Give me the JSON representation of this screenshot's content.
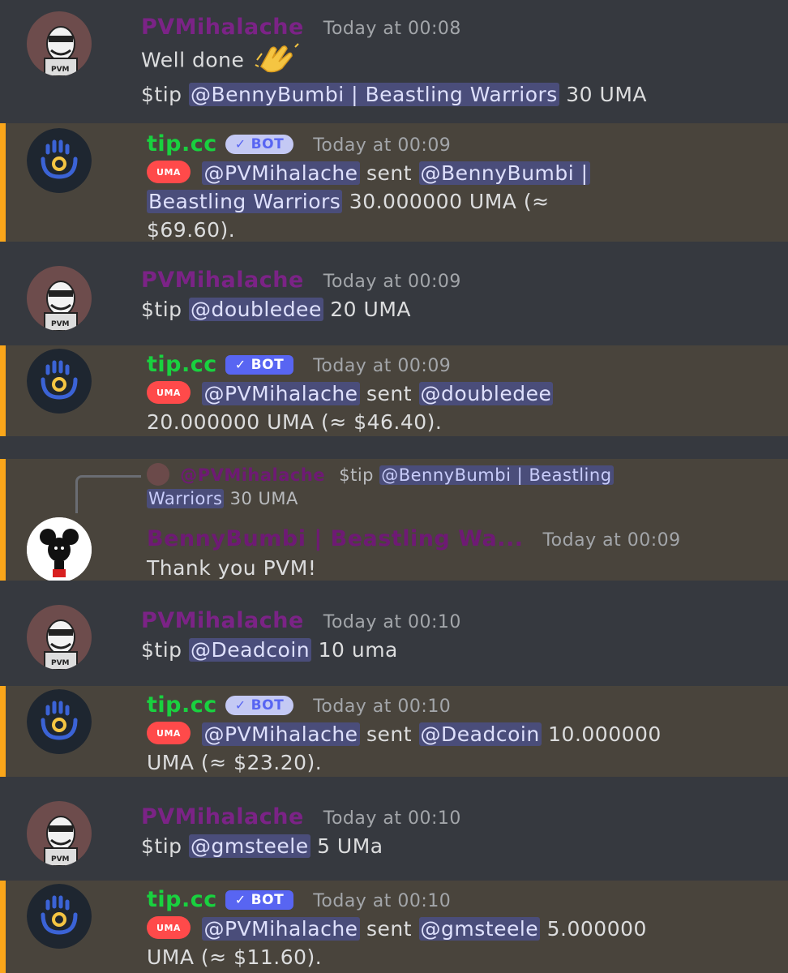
{
  "colors": {
    "background": "#36393f",
    "highlight_background": "#49443c",
    "highlight_border": "#faa61a",
    "user_name": "#7b2386",
    "bot_name": "#19d13f",
    "mention_bg": "#4a4d7a",
    "bot_tag": "#5865f2",
    "uma_badge": "#ff4a4a"
  },
  "messages": [
    {
      "author": "PVMihalache",
      "timestamp": "Today at 00:08",
      "line1": "Well done",
      "line1_emoji": "clapping-hands",
      "line2_prefix": "$tip",
      "line2_mention": "@BennyBumbi | Beastling Warriors",
      "line2_suffix": "30 UMA"
    },
    {
      "author": "tip.cc",
      "bot_label": "BOT",
      "timestamp": "Today at 00:09",
      "badge": "UMA",
      "sender": "@PVMihalache",
      "verb": "sent",
      "recipient_part1": "@BennyBumbi |",
      "recipient_part2": "Beastling Warriors",
      "amount": "30.000000 UMA (≈",
      "value": "$69.60)."
    },
    {
      "author": "PVMihalache",
      "timestamp": "Today at 00:09",
      "prefix": "$tip",
      "mention": "@doubledee",
      "suffix": "20 UMA"
    },
    {
      "author": "tip.cc",
      "bot_label": "BOT",
      "timestamp": "Today at 00:09",
      "badge": "UMA",
      "sender": "@PVMihalache",
      "verb": "sent",
      "recipient": "@doubledee",
      "amount": "20.000000 UMA (≈ $46.40)."
    },
    {
      "reply_author": "@PVMihalache",
      "reply_prefix": "$tip",
      "reply_mention_part1": "@BennyBumbi | Beastling",
      "reply_mention_part2": "Warriors",
      "reply_suffix": "30 UMA",
      "author": "BennyBumbi | Beastling Wa...",
      "timestamp": "Today at 00:09",
      "text": "Thank you PVM!"
    },
    {
      "author": "PVMihalache",
      "timestamp": "Today at 00:10",
      "prefix": "$tip",
      "mention": "@Deadcoin",
      "suffix": "10 uma"
    },
    {
      "author": "tip.cc",
      "bot_label": "BOT",
      "timestamp": "Today at 00:10",
      "badge": "UMA",
      "sender": "@PVMihalache",
      "verb": "sent",
      "recipient": "@Deadcoin",
      "amount_part1": "10.000000",
      "amount_part2": "UMA (≈ $23.20)."
    },
    {
      "author": "PVMihalache",
      "timestamp": "Today at 00:10",
      "prefix": "$tip",
      "mention": "@gmsteele",
      "suffix": "5 UMa"
    },
    {
      "author": "tip.cc",
      "bot_label": "BOT",
      "timestamp": "Today at 00:10",
      "badge": "UMA",
      "sender": "@PVMihalache",
      "verb": "sent",
      "recipient": "@gmsteele",
      "amount_part1": "5.000000",
      "amount_part2": "UMA (≈ $11.60)."
    }
  ]
}
